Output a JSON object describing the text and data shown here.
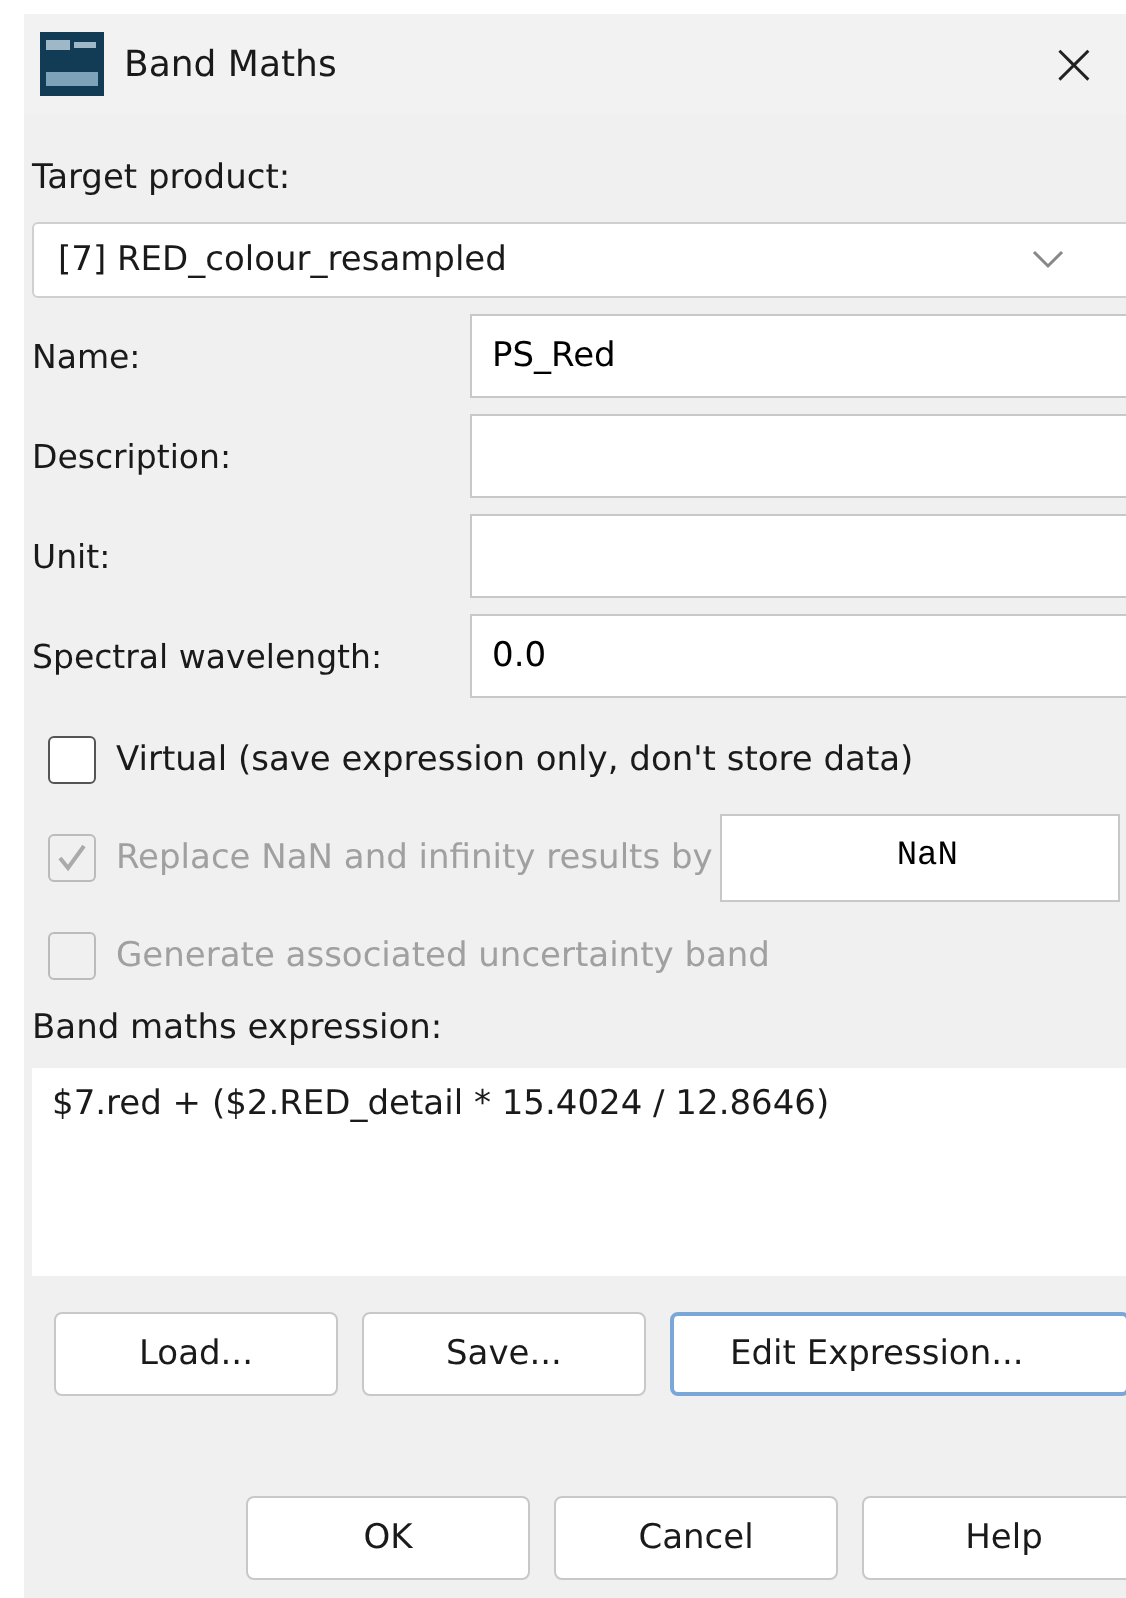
{
  "window": {
    "title": "Band Maths",
    "close": "×"
  },
  "target_product": {
    "label": "Target product:",
    "value": "[7] RED_colour_resampled"
  },
  "fields": [
    {
      "label": "Name:",
      "value": "PS_Red"
    },
    {
      "label": "Description:"
    },
    {
      "label": "Unit:"
    },
    {
      "label": "Spectral wavelength:",
      "value": "0.0"
    }
  ],
  "options": [
    {
      "label": "Virtual (save expression only, don't store data)",
      "checked": false,
      "disabled": false
    },
    {
      "label": "Replace NaN and infinity results by",
      "checked": true,
      "disabled": true,
      "value": "NaN"
    },
    {
      "label": "Generate associated uncertainty band",
      "checked": false,
      "disabled": true
    }
  ],
  "expression": {
    "label": "Band maths expression:",
    "value": "$7.red + ($2.RED_detail * 15.4024 / 12.8646)"
  },
  "expression_buttons": [
    {
      "label": "Load...",
      "focused": false
    },
    {
      "label": "Save...",
      "focused": false
    },
    {
      "label": "Edit Expression...",
      "focused": true
    }
  ],
  "dialog_buttons": [
    {
      "label": "OK"
    },
    {
      "label": "Cancel"
    },
    {
      "label": "Help"
    }
  ]
}
